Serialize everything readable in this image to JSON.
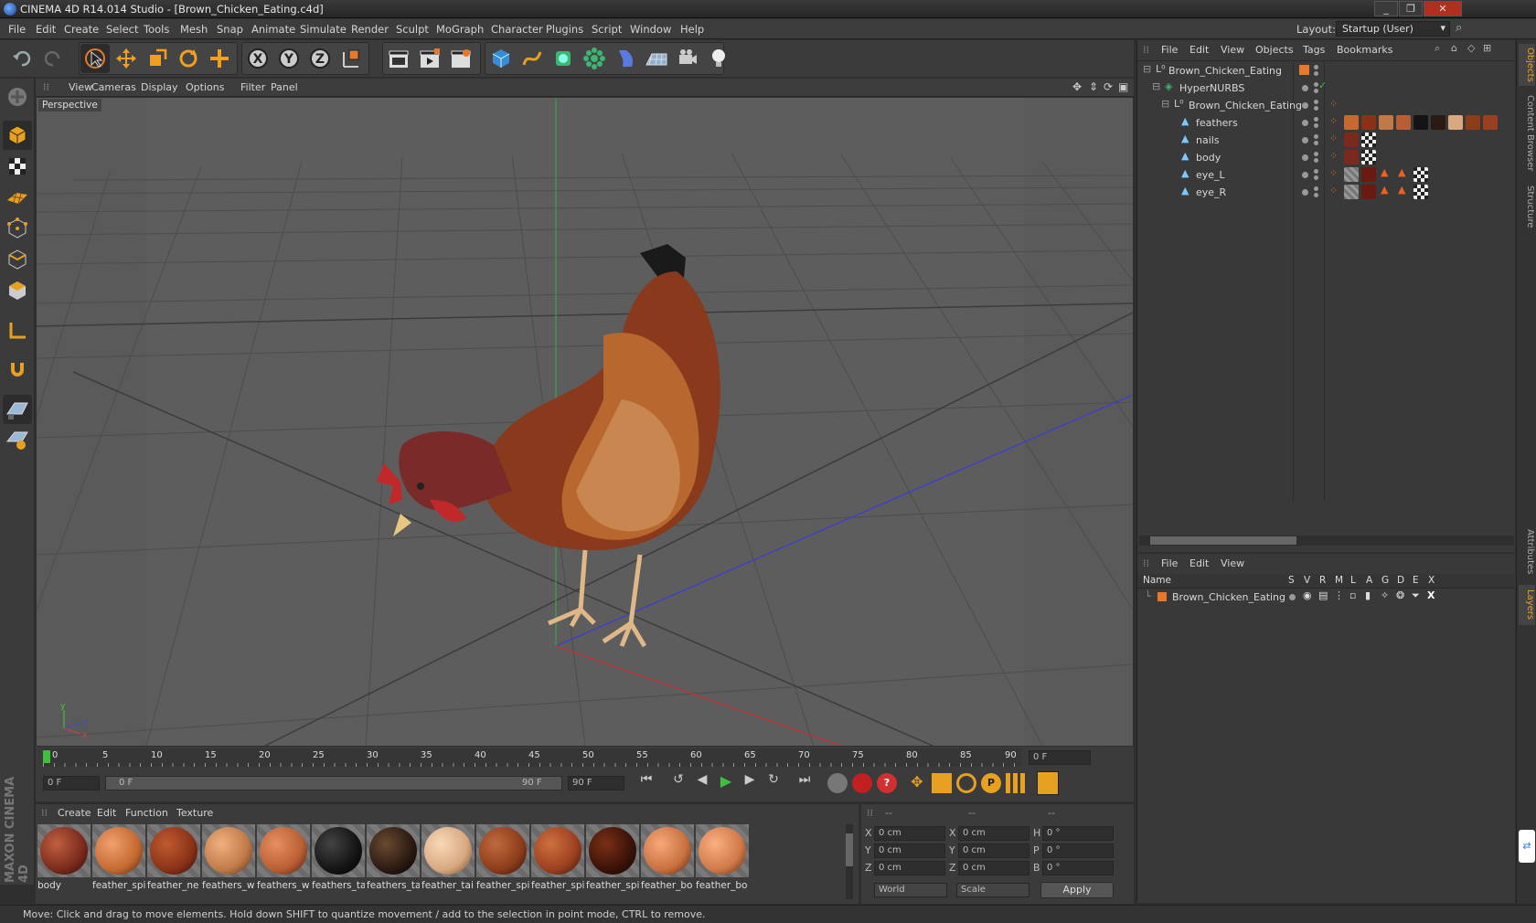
{
  "window": {
    "title": "CINEMA 4D R14.014 Studio - [Brown_Chicken_Eating.c4d]"
  },
  "menu": [
    "File",
    "Edit",
    "Create",
    "Select",
    "Tools",
    "Mesh",
    "Snap",
    "Animate",
    "Simulate",
    "Render",
    "Sculpt",
    "MoGraph",
    "Character",
    "Plugins",
    "Script",
    "Window",
    "Help"
  ],
  "layout": {
    "label": "Layout:",
    "value": "Startup (User)"
  },
  "viewport": {
    "menu": [
      "View",
      "Cameras",
      "Display",
      "Options",
      "Filter",
      "Panel"
    ],
    "label": "Perspective"
  },
  "timeline": {
    "ticks": [
      "0",
      "5",
      "10",
      "15",
      "20",
      "25",
      "30",
      "35",
      "40",
      "45",
      "50",
      "55",
      "60",
      "65",
      "70",
      "75",
      "80",
      "85",
      "90"
    ],
    "current_frame": "0 F",
    "start_field": "0 F",
    "range_start": "0 F",
    "range_end": "90 F",
    "end_field": "90 F"
  },
  "materials": {
    "menu": [
      "Create",
      "Edit",
      "Function",
      "Texture"
    ],
    "items": [
      {
        "name": "body",
        "color": "#7a2a1c"
      },
      {
        "name": "feather_spi",
        "color": "#c46a30"
      },
      {
        "name": "feather_ne",
        "color": "#8a3218"
      },
      {
        "name": "feathers_w",
        "color": "#c07a48"
      },
      {
        "name": "feathers_w",
        "color": "#b85e34"
      },
      {
        "name": "feathers_ta",
        "color": "#141414"
      },
      {
        "name": "feathers_ta",
        "color": "#2a1a12"
      },
      {
        "name": "feather_tai",
        "color": "#d8a880"
      },
      {
        "name": "feather_spi",
        "color": "#8c3c1a"
      },
      {
        "name": "feather_spi",
        "color": "#9a4020"
      },
      {
        "name": "feather_spi",
        "color": "#3a1208"
      },
      {
        "name": "feather_bo",
        "color": "#c87040"
      },
      {
        "name": "feather_bo",
        "color": "#d07848"
      }
    ]
  },
  "coords": {
    "header": [
      "--",
      "--",
      "--"
    ],
    "rows": [
      {
        "a": "X",
        "av": "0 cm",
        "b": "X",
        "bv": "0 cm",
        "c": "H",
        "cv": "0 °"
      },
      {
        "a": "Y",
        "av": "0 cm",
        "b": "Y",
        "bv": "0 cm",
        "c": "P",
        "cv": "0 °"
      },
      {
        "a": "Z",
        "av": "0 cm",
        "b": "Z",
        "bv": "0 cm",
        "c": "B",
        "cv": "0 °"
      }
    ],
    "mode": "World",
    "scale": "Scale",
    "apply": "Apply"
  },
  "objects": {
    "menu": [
      "File",
      "Edit",
      "View",
      "Objects",
      "Tags",
      "Bookmarks"
    ],
    "tree": [
      {
        "name": "Brown_Chicken_Eating",
        "indent": 0
      },
      {
        "name": "HyperNURBS",
        "indent": 1
      },
      {
        "name": "Brown_Chicken_Eating",
        "indent": 2
      },
      {
        "name": "feathers",
        "indent": 3
      },
      {
        "name": "nails",
        "indent": 3
      },
      {
        "name": "body",
        "indent": 3
      },
      {
        "name": "eye_L",
        "indent": 3
      },
      {
        "name": "eye_R",
        "indent": 3
      }
    ]
  },
  "layers": {
    "menu": [
      "File",
      "Edit",
      "View"
    ],
    "columns": [
      "Name",
      "S",
      "V",
      "R",
      "M",
      "L",
      "A",
      "G",
      "D",
      "E",
      "X"
    ],
    "rows": [
      "Brown_Chicken_Eating"
    ]
  },
  "side_tabs": [
    "Objects",
    "Content Browser",
    "Structure",
    "Attributes",
    "Layers"
  ],
  "status": "Move: Click and drag to move elements. Hold down SHIFT to quantize movement / add to the selection in point mode, CTRL to remove.",
  "brand": "MAXON CINEMA 4D",
  "colors": {
    "accent": "#e87a28",
    "panel": "#393939",
    "selection": "#4a6fa5"
  }
}
